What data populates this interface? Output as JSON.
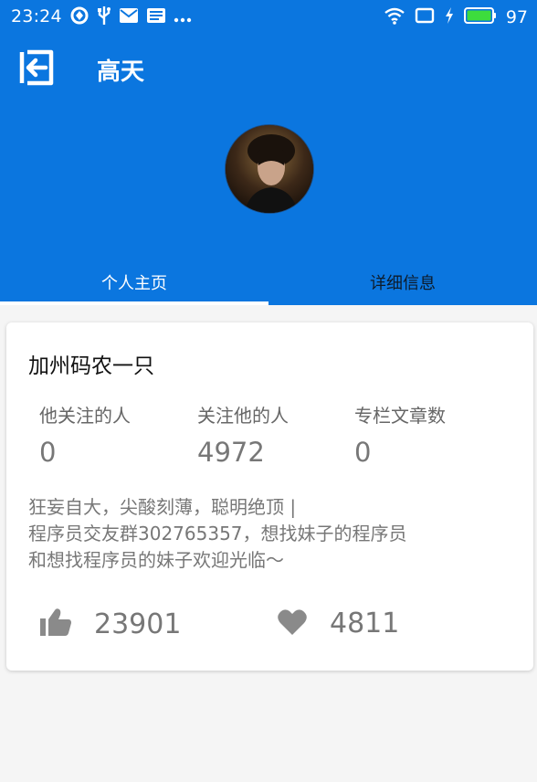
{
  "status_bar": {
    "time": "23:24",
    "battery": "97",
    "icons_left": [
      "sync-icon",
      "usb-icon",
      "mail-icon",
      "news-icon",
      "more-icon"
    ],
    "icons_right": [
      "wifi-icon",
      "screen-icon",
      "charging-icon",
      "battery-icon"
    ],
    "battery_color": "#3ddc3d"
  },
  "header": {
    "title": "高天",
    "background_color": "#0b76df"
  },
  "tabs": [
    {
      "label": "个人主页",
      "active": true
    },
    {
      "label": "详细信息",
      "active": false
    }
  ],
  "profile": {
    "name": "加州码农一只",
    "stats": [
      {
        "label": "他关注的人",
        "value": "0"
      },
      {
        "label": "关注他的人",
        "value": "4972"
      },
      {
        "label": "专栏文章数",
        "value": "0"
      }
    ],
    "bio_lines": [
      "狂妄自大，尖酸刻薄，聪明绝顶 |",
      "程序员交友群302765357，想找妹子的程序员",
      "和想找程序员的妹子欢迎光临～"
    ],
    "likes": "23901",
    "favorites": "4811"
  }
}
